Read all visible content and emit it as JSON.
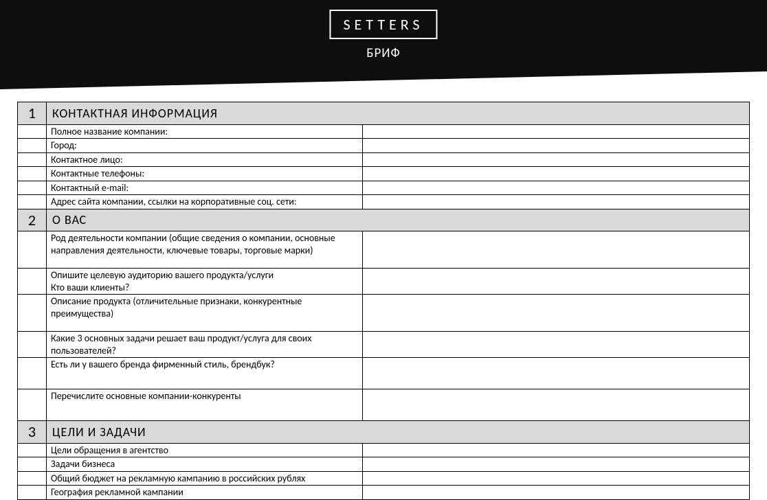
{
  "header": {
    "brand": "SETTERS",
    "subtitle": "БРИФ"
  },
  "sections": [
    {
      "num": "1",
      "title": "КОНТАКТНАЯ  ИНФОРМАЦИЯ",
      "rows": [
        {
          "label": "Полное название компании:",
          "value": ""
        },
        {
          "label": "Город:",
          "value": ""
        },
        {
          "label": "Контактное лицо:",
          "value": ""
        },
        {
          "label": "Контактные телефоны:",
          "value": ""
        },
        {
          "label": "Контактный e-mail:",
          "value": ""
        },
        {
          "label": "Адрес сайта компании, ссылки на корпоративные соц. сети:",
          "value": ""
        }
      ]
    },
    {
      "num": "2",
      "title": "О ВАС",
      "rows": [
        {
          "label": "Род деятельности компании (общие сведения о компании, основные направления деятельности, ключевые товары, торговые марки)",
          "value": "",
          "tall": true
        },
        {
          "label": "Опишите целевую аудиторию вашего продукта/услуги\nКто ваши клиенты?",
          "value": ""
        },
        {
          "label": "Описание продукта (отличительные признаки, конкурентные преимущества)",
          "value": "",
          "tall": true
        },
        {
          "label": "Какие 3  основных задачи  решает ваш продукт/услуга для своих пользователей?",
          "value": ""
        },
        {
          "label": "Есть ли у вашего бренда фирменный стиль, брендбук?",
          "value": "",
          "multi": true
        },
        {
          "label": "Перечислите основные компании-конкуренты",
          "value": "",
          "multi": true
        }
      ]
    },
    {
      "num": "3",
      "title": "ЦЕЛИ  И  ЗАДАЧИ",
      "rows": [
        {
          "label": "Цели обращения в агентство",
          "value": ""
        },
        {
          "label": "Задачи бизнеса",
          "value": ""
        },
        {
          "label": "Общий бюджет на рекламную кампанию в российских рублях",
          "value": ""
        },
        {
          "label": "География рекламной кампании",
          "value": ""
        }
      ]
    }
  ]
}
